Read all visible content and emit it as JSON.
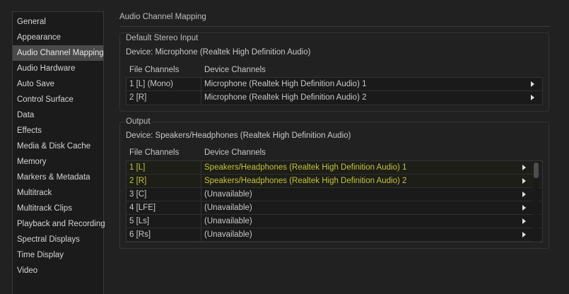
{
  "sidebar": {
    "items": [
      {
        "label": "General"
      },
      {
        "label": "Appearance"
      },
      {
        "label": "Audio Channel Mapping"
      },
      {
        "label": "Audio Hardware"
      },
      {
        "label": "Auto Save"
      },
      {
        "label": "Control Surface"
      },
      {
        "label": "Data"
      },
      {
        "label": "Effects"
      },
      {
        "label": "Media & Disk Cache"
      },
      {
        "label": "Memory"
      },
      {
        "label": "Markers & Metadata"
      },
      {
        "label": "Multitrack"
      },
      {
        "label": "Multitrack Clips"
      },
      {
        "label": "Playback and Recording"
      },
      {
        "label": "Spectral Displays"
      },
      {
        "label": "Time Display"
      },
      {
        "label": "Video"
      }
    ],
    "selected": "Audio Channel Mapping"
  },
  "main": {
    "title": "Audio Channel Mapping",
    "input": {
      "section": "Default Stereo Input",
      "device": "Device: Microphone (Realtek High Definition Audio)",
      "col_file": "File Channels",
      "col_device": "Device Channels",
      "rows": [
        {
          "file": "1 [L] (Mono)",
          "device": "Microphone (Realtek High Definition Audio) 1"
        },
        {
          "file": "2 [R]",
          "device": "Microphone (Realtek High Definition Audio) 2"
        }
      ]
    },
    "output": {
      "section": "Output",
      "device": "Device: Speakers/Headphones (Realtek High Definition Audio)",
      "col_file": "File Channels",
      "col_device": "Device Channels",
      "rows": [
        {
          "file": "1 [L]",
          "device": "Speakers/Headphones (Realtek High Definition Audio) 1",
          "highlighted": true
        },
        {
          "file": "2 [R]",
          "device": "Speakers/Headphones (Realtek High Definition Audio) 2",
          "highlighted": true
        },
        {
          "file": "3 [C]",
          "device": "(Unavailable)"
        },
        {
          "file": "4 [LFE]",
          "device": "(Unavailable)"
        },
        {
          "file": "5 [Ls]",
          "device": "(Unavailable)"
        },
        {
          "file": "6 [Rs]",
          "device": "(Unavailable)"
        }
      ]
    }
  },
  "colors": {
    "background": "#212121",
    "selected_item": "#4a4a4a",
    "highlight_text": "#c3c23a"
  },
  "icons": {
    "row_arrow": "chevron-right-icon",
    "scroll": "scrollbar-thumb"
  }
}
